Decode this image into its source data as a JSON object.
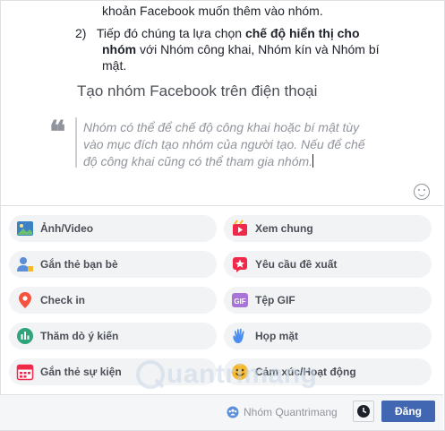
{
  "editor": {
    "line1": "khoản Facebook muốn thêm vào nhóm.",
    "step2_num": "2)",
    "step2_pre": "Tiếp đó chúng ta lựa chọn ",
    "step2_bold1": "chế độ hiển thị cho",
    "step2_bold2": "nhóm",
    "step2_post": " với Nhóm công khai, Nhóm kín và Nhóm bí",
    "step2_line3": "mật.",
    "heading": "Tạo nhóm Facebook trên điện thoại",
    "quote_mark": "❝",
    "quote_line1": "Nhóm có thể để chế độ công khai hoặc bí mật tùy",
    "quote_line2": "vào mục đích tạo nhóm của người tạo. Nếu để chế",
    "quote_line3": "độ công khai cũng có thể tham gia nhóm."
  },
  "options": [
    {
      "label": "Ảnh/Video",
      "icon": "photo-video-icon",
      "color": "#45bd62"
    },
    {
      "label": "Xem chung",
      "icon": "watch-party-icon",
      "color": "#f02849"
    },
    {
      "label": "Gắn thẻ bạn bè",
      "icon": "tag-friends-icon",
      "color": "#1877f2"
    },
    {
      "label": "Yêu cầu đề xuất",
      "icon": "recommendation-icon",
      "color": "#f02849"
    },
    {
      "label": "Check in",
      "icon": "location-pin-icon",
      "color": "#f5533d"
    },
    {
      "label": "Tệp GIF",
      "icon": "gif-icon",
      "color": "#a974d8"
    },
    {
      "label": "Thăm dò ý kiến",
      "icon": "poll-icon",
      "color": "#45bd62"
    },
    {
      "label": "Họp mặt",
      "icon": "wave-hand-icon",
      "color": "#1877f2"
    },
    {
      "label": "Gắn thẻ sự kiện",
      "icon": "event-calendar-icon",
      "color": "#f02849"
    },
    {
      "label": "Cảm xúc/Hoạt động",
      "icon": "feeling-emoji-icon",
      "color": "#f7b928"
    }
  ],
  "footer": {
    "audience": "Nhóm Quantrimang",
    "post_label": "Đăng"
  },
  "watermark": "uantrimang"
}
